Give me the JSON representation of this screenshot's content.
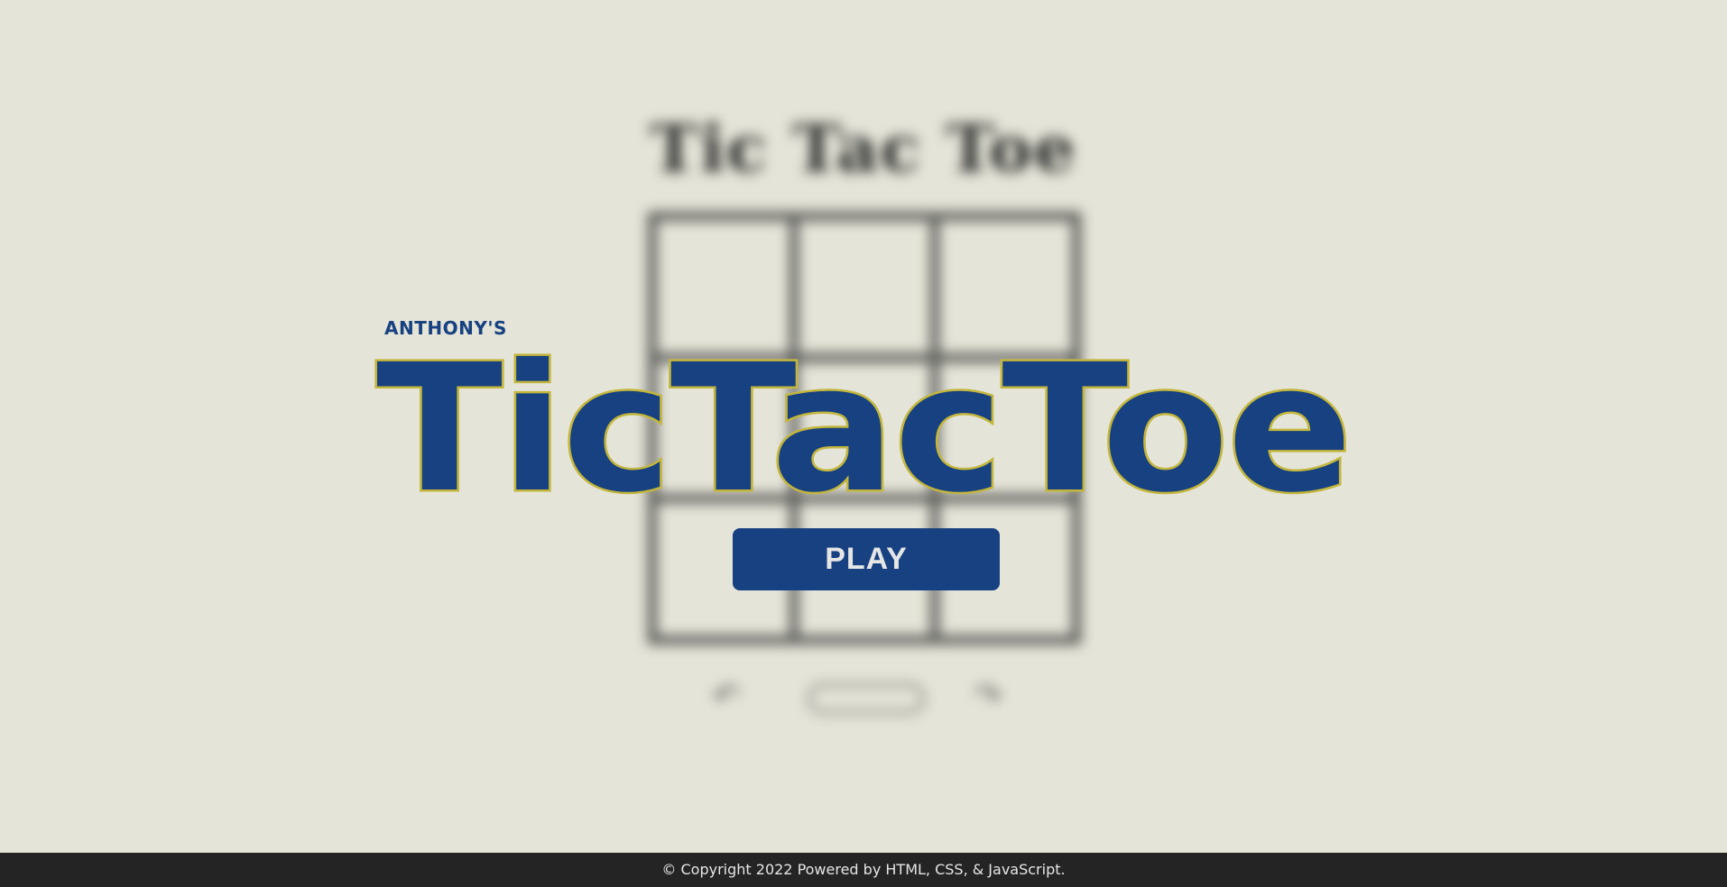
{
  "background_game": {
    "title": "Tic Tac Toe",
    "undo_icon": "undo-icon",
    "redo_icon": "redo-icon",
    "undo_glyph": "↶",
    "redo_glyph": "↷"
  },
  "splash": {
    "owner": "ANTHONY'S",
    "logo": "TicTacToe",
    "play_label": "PLAY"
  },
  "footer": {
    "text": "© Copyright 2022 Powered by HTML, CSS, & JavaScript."
  },
  "colors": {
    "background": "#e4e4d8",
    "brand_blue": "#174180",
    "logo_outline": "#c3b63d",
    "footer_bg": "#242424",
    "footer_text": "#e6e6e6"
  }
}
